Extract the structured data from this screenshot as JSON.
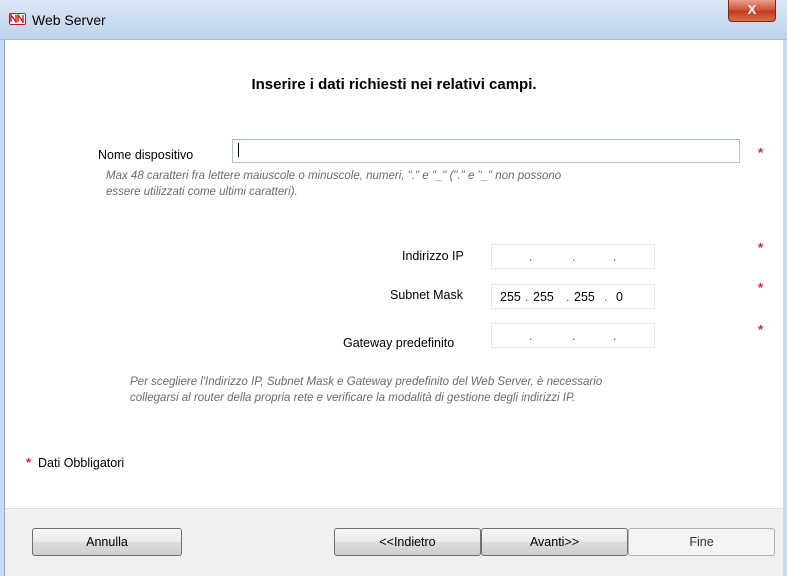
{
  "window": {
    "title": "Web Server",
    "close_glyph": "X",
    "app_icon": "nn-logo-icon"
  },
  "main": {
    "heading": "Inserire i dati richiesti nei relativi campi.",
    "device_name": {
      "label": "Nome dispositivo",
      "value": "",
      "hint_line1": "Max 48 caratteri fra lettere maiuscole o minuscole, numeri, \".\" e \"_\" (\".\" e \"_\" non possono",
      "hint_line2": "essere utilizzati come ultimi caratteri)."
    },
    "ip_address": {
      "label": "Indirizzo IP",
      "octets": [
        "",
        "",
        "",
        ""
      ]
    },
    "subnet_mask": {
      "label": "Subnet Mask",
      "octets": [
        "255",
        "255",
        "255",
        "0"
      ]
    },
    "gateway": {
      "label": "Gateway predefinito",
      "octets": [
        "",
        "",
        "",
        ""
      ]
    },
    "info_line1": "Per scegliere l'Indirizzo IP, Subnet Mask e Gateway predefinito del Web Server, è necessario",
    "info_line2": "collegarsi al router della propria rete e verificare la modalità di gestione degli indirizzi IP.",
    "required_star": "*",
    "required_note": "Dati Obbligatori"
  },
  "footer": {
    "cancel": "Annulla",
    "back": "<<Indietro",
    "next": "Avanti>>",
    "finish": "Fine"
  },
  "colors": {
    "required": "#e02020",
    "hint_text": "#6a6a6a"
  }
}
